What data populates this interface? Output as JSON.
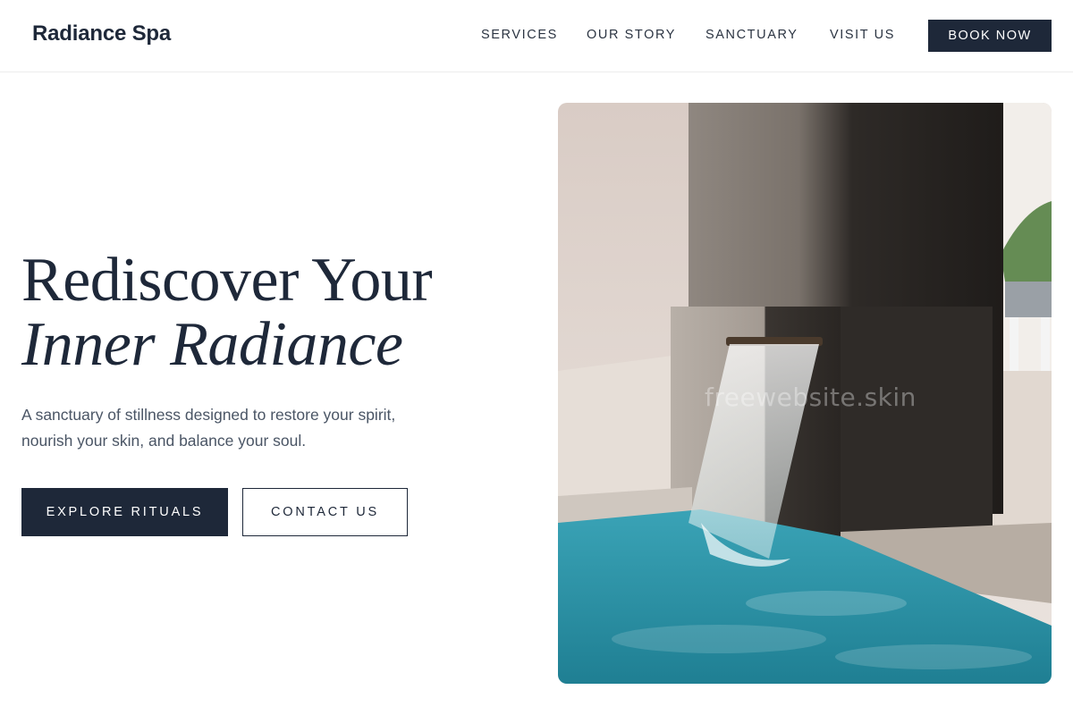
{
  "header": {
    "brand": "Radiance Spa",
    "nav": [
      "SERVICES",
      "OUR STORY",
      "SANCTUARY",
      "VISIT US"
    ],
    "cta": "BOOK NOW"
  },
  "hero": {
    "title_line1": "Rediscover Your",
    "title_line2": "Inner Radiance",
    "subtitle": "A sanctuary of stillness designed to restore your spirit, nourish your skin, and balance your soul.",
    "primary_button": "EXPLORE RITUALS",
    "secondary_button": "CONTACT US",
    "image_alt": "Spa pool with waterfall fountain",
    "watermark": "freewebsite.skin"
  },
  "colors": {
    "primary": "#1e2839",
    "text_muted": "#4a5565",
    "pool": "#2b8ea0"
  }
}
